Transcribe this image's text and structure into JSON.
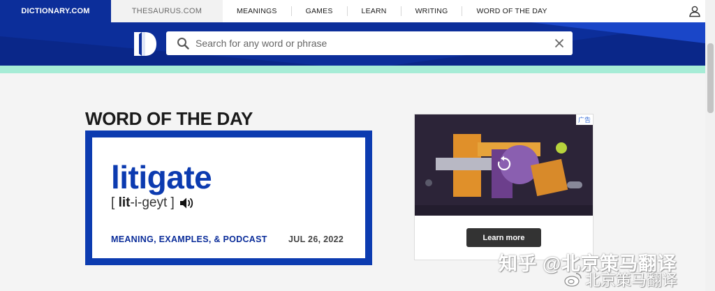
{
  "header": {
    "tabs": [
      {
        "label": "DICTIONARY.COM"
      },
      {
        "label": "THESAURUS.COM"
      }
    ],
    "nav": [
      {
        "label": "MEANINGS"
      },
      {
        "label": "GAMES"
      },
      {
        "label": "LEARN"
      },
      {
        "label": "WRITING"
      },
      {
        "label": "WORD OF THE DAY"
      }
    ],
    "user_icon": "user-icon"
  },
  "search": {
    "placeholder": "Search for any word or phrase",
    "value": "",
    "search_icon": "search-icon",
    "clear_icon": "close-icon"
  },
  "wotd": {
    "heading": "WORD OF THE DAY",
    "word": "litigate",
    "pronunciation": {
      "open": "[",
      "stressed": "lit",
      "rest": "-i-geyt",
      "close": "]"
    },
    "meaning_link": "MEANING, EXAMPLES, & PODCAST",
    "date": "JUL 26, 2022"
  },
  "ad": {
    "badge": "广告",
    "button_label": "Learn more",
    "replay_icon": "replay-icon"
  },
  "watermark": {
    "line1": "知乎 @北京策马翻译",
    "line2": "北京策马翻译"
  },
  "colors": {
    "brand_blue": "#0c2e9a",
    "word_blue": "#0c3bb0",
    "mint": "#a6ecd6"
  }
}
